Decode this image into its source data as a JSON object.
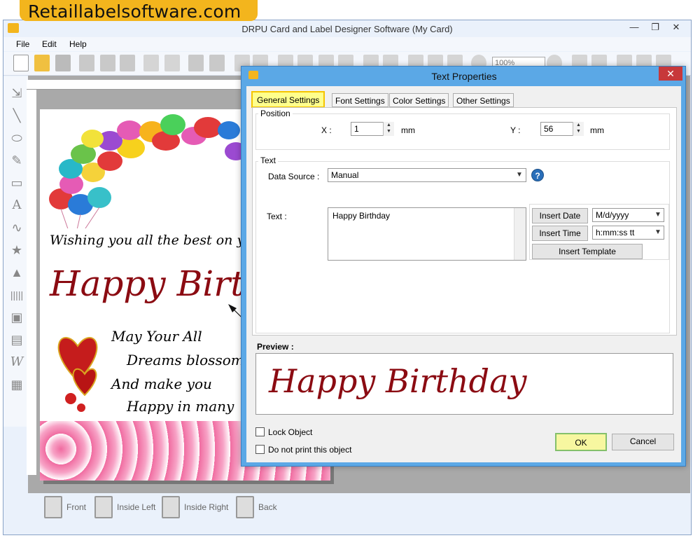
{
  "banner": {
    "text": "Retaillabelsoftware.com"
  },
  "window": {
    "title": "DRPU Card and Label Designer Software  (My Card)",
    "controls": [
      "—",
      "❐",
      "✕"
    ]
  },
  "menu": [
    {
      "label": "File"
    },
    {
      "label": "Edit"
    },
    {
      "label": "Help"
    }
  ],
  "toolbar": {
    "zoom_value": "100%"
  },
  "card": {
    "wish_line": "Wishing you all the best on your",
    "headline": "Happy Birt",
    "verse": [
      "May Your All",
      "Dreams blossom",
      "And make you",
      "Happy in many"
    ]
  },
  "pages": [
    {
      "label": "Front"
    },
    {
      "label": "Inside Left"
    },
    {
      "label": "Inside Right"
    },
    {
      "label": "Back"
    }
  ],
  "dialog": {
    "title": "Text Properties",
    "close": "✕",
    "tabs": [
      {
        "label": "General Settings",
        "active": true
      },
      {
        "label": "Font Settings",
        "active": false
      },
      {
        "label": "Color Settings",
        "active": false
      },
      {
        "label": "Other Settings",
        "active": false
      }
    ],
    "position": {
      "group_label": "Position",
      "x_label": "X :",
      "x_value": "1",
      "x_unit": "mm",
      "y_label": "Y :",
      "y_value": "56",
      "y_unit": "mm"
    },
    "text_group": {
      "group_label": "Text",
      "data_source_label": "Data Source :",
      "data_source_value": "Manual",
      "text_label": "Text :",
      "text_value": "Happy Birthday",
      "insert_date_label": "Insert Date",
      "date_format": "M/d/yyyy",
      "insert_time_label": "Insert Time",
      "time_format": "h:mm:ss tt",
      "insert_template_label": "Insert Template"
    },
    "preview_label": "Preview :",
    "preview_text": "Happy Birthday",
    "lock_object_label": "Lock Object",
    "do_not_print_label": "Do not print this object",
    "ok_label": "OK",
    "cancel_label": "Cancel"
  },
  "colors": {
    "accent_title_red": "#8b0b12",
    "dialog_frame": "#5ba8e6",
    "active_tab": "#ffff8c",
    "banner": "#f3b51d"
  }
}
